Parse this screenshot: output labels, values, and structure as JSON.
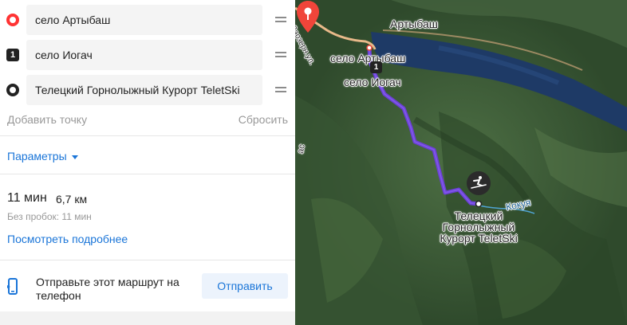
{
  "route_panel": {
    "points": [
      {
        "marker": "start",
        "value": "село Артыбаш"
      },
      {
        "marker": "1",
        "value": "село Иогач"
      },
      {
        "marker": "end",
        "value": "Телецкий Горнолыжный Курорт TeletSki"
      }
    ],
    "add_point_label": "Добавить точку",
    "reset_label": "Сбросить",
    "params_label": "Параметры"
  },
  "route_summary": {
    "duration": "11 мин",
    "distance": "6,7 км",
    "no_traffic": "Без пробок: 11 мин",
    "details_link": "Посмотреть подробнее"
  },
  "send_block": {
    "text": "Отправьте этот маршрут на телефон",
    "button_label": "Отправить"
  },
  "map": {
    "labels": {
      "village_top": "Артыбаш",
      "start_label": "село Артыбаш",
      "waypoint_label": "село Иогач",
      "waypoint_number": "1",
      "river": "Кокуя",
      "resort_line1": "Телецкий",
      "resort_line2": "Горнолыжный",
      "resort_line3": "Курорт TeletSki",
      "road_fragment": "Заозерн.ул.",
      "side_fragment": "ас"
    },
    "colors": {
      "route": "#6a3fd6",
      "road": "#e8b98a",
      "lake": "#1e3a66",
      "pin": "#f0453a"
    }
  },
  "colors": {
    "accent": "#1a75d8",
    "start_marker": "#ff3333",
    "button_bg": "#ecf3fc"
  }
}
